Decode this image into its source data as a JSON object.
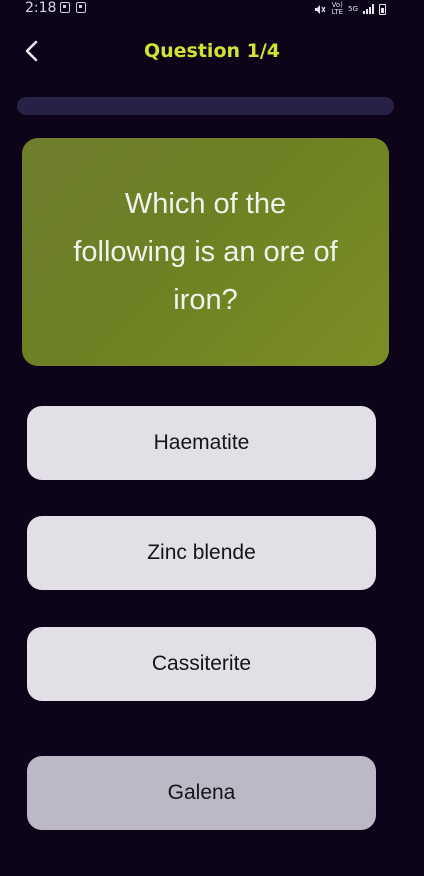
{
  "status_bar": {
    "time": "2:18",
    "network": [
      "Vo)",
      "LTE"
    ],
    "network_type": "5G"
  },
  "header": {
    "title": "Question 1/4",
    "accent_color": "#d4e233"
  },
  "progress": {
    "fraction": 0.0
  },
  "question": {
    "text": "Which of the following is an ore of iron?"
  },
  "answers": [
    {
      "label": "Haematite"
    },
    {
      "label": "Zinc blende"
    },
    {
      "label": "Cassiterite"
    },
    {
      "label": "Galena"
    }
  ],
  "colors": {
    "background": "#0d0419",
    "card": "#6f7d2c",
    "answer": "#e2e0e6",
    "answer_dimmed": "#bdb8c6"
  },
  "icons": {
    "back": "chevron-left-icon"
  }
}
